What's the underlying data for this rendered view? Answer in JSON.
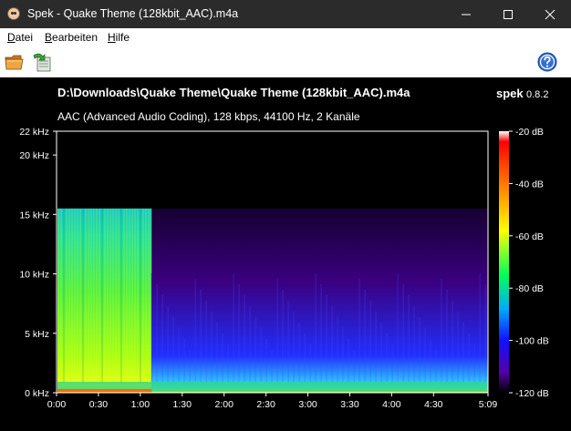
{
  "window": {
    "title": "Spek - Quake Theme (128kbit_AAC).m4a",
    "icons": {
      "app": "spek-face-icon",
      "minimize": "minimize-icon",
      "maximize": "maximize-icon",
      "close": "close-icon"
    }
  },
  "menu": {
    "items": [
      {
        "ul": "D",
        "rest": "atei"
      },
      {
        "ul": "B",
        "rest": "earbeiten"
      },
      {
        "ul": "H",
        "rest": "ilfe"
      }
    ]
  },
  "toolbar": {
    "icons": [
      "open-folder-icon",
      "save-export-icon",
      "help-icon"
    ]
  },
  "view": {
    "file_path": "D:\\Downloads\\Quake Theme\\Quake Theme (128kbit_AAC).m4a",
    "brand_name": "spek",
    "brand_version": "0.8.2",
    "audio_info": "AAC (Advanced Audio Coding), 128 kbps, 44100 Hz, 2 Kanäle"
  },
  "chart_data": {
    "type": "heatmap",
    "x_ticks": [
      "0:00",
      "0:30",
      "1:00",
      "1:30",
      "2:00",
      "2:30",
      "3:00",
      "3:30",
      "4:00",
      "4:30",
      "5:09"
    ],
    "x_tick_seconds": [
      0,
      30,
      60,
      90,
      120,
      150,
      180,
      210,
      240,
      270,
      309
    ],
    "x_range_seconds": [
      0,
      309
    ],
    "y_ticks": [
      "0 kHz",
      "5 kHz",
      "10 kHz",
      "15 kHz",
      "20 kHz",
      "22 kHz"
    ],
    "y_tick_khz": [
      0,
      5,
      10,
      15,
      20,
      22
    ],
    "y_range_khz": [
      0,
      22
    ],
    "scale_ticks": [
      "-20 dB",
      "-40 dB",
      "-60 dB",
      "-80 dB",
      "-100 dB",
      "-120 dB"
    ],
    "scale_db": [
      -20,
      -40,
      -60,
      -80,
      -100,
      -120
    ],
    "scale_range_db": [
      -120,
      -20
    ],
    "lowpass_cutoff_khz": 15.5,
    "loud_section_end_seconds": 68,
    "colormap": [
      "#ffffff",
      "#ff0000",
      "#ff8800",
      "#ffff00",
      "#00ff55",
      "#00aaff",
      "#1111ff",
      "#5500aa",
      "#000000"
    ]
  }
}
